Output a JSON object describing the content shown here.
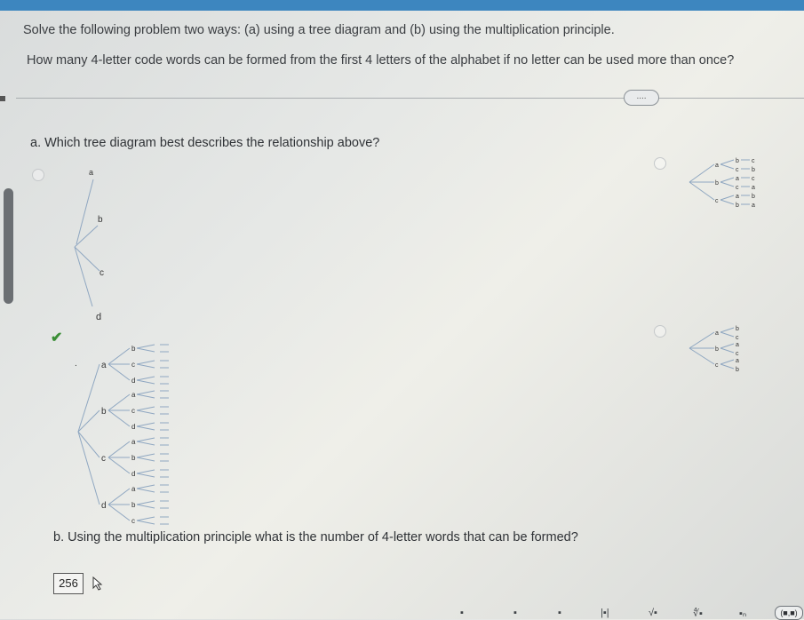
{
  "problem": {
    "line1": "Solve the following problem two ways: (a) using a tree diagram and (b) using the multiplication principle.",
    "line2": "How many 4-letter code words can be formed from the first 4 letters of the alphabet if no letter can be used more than once?"
  },
  "more_button": "....",
  "part_a": {
    "question": "a. Which tree diagram best describes the relationship above?",
    "selected_option": 2
  },
  "part_b": {
    "question": "b. Using the multiplication principle what is the number of 4-letter words that can be formed?",
    "answer": "256"
  },
  "option1_tree": {
    "labels": [
      "a",
      "b",
      "c",
      "d"
    ]
  },
  "option2_tree": {
    "level1": [
      "a",
      "b",
      "c",
      "d"
    ],
    "level2": [
      [
        "b",
        "c",
        "d"
      ],
      [
        "a",
        "c",
        "d"
      ],
      [
        "a",
        "b",
        "d"
      ],
      [
        "a",
        "b",
        "c"
      ]
    ]
  },
  "option3_tree": {
    "level1": [
      "a",
      "b",
      "c"
    ],
    "level2": [
      "b",
      "c",
      "a",
      "c",
      "a",
      "b"
    ],
    "level3": [
      "c",
      "b",
      "c",
      "a",
      "b",
      "a"
    ]
  },
  "option4_tree": {
    "level1": [
      "a",
      "b",
      "c"
    ],
    "level2": [
      "b",
      "c",
      "a",
      "c",
      "a",
      "b"
    ]
  },
  "toolbar": {
    "matrix_label": "(■,■)"
  }
}
